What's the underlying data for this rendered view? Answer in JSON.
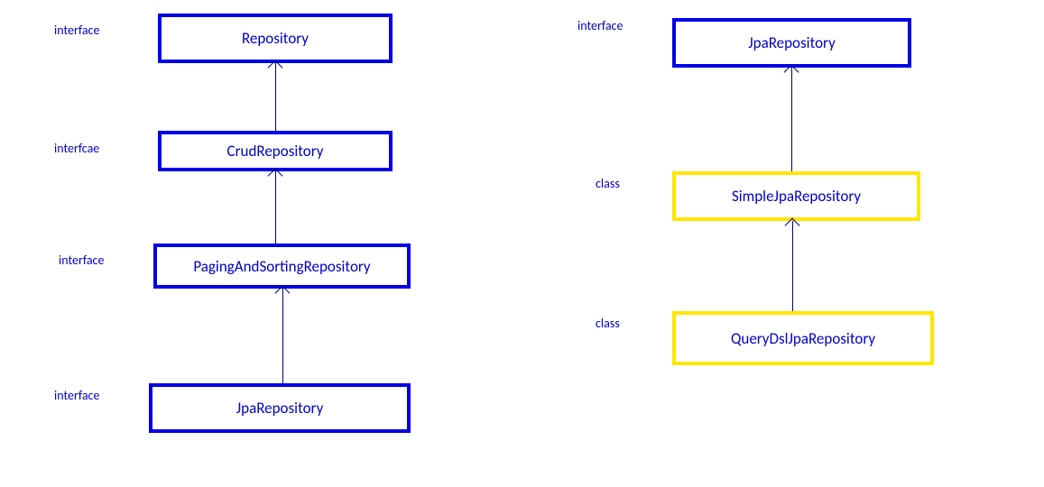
{
  "left": {
    "label1": "interface",
    "box1": "Repository",
    "label2": "interfcae",
    "box2": "CrudRepository",
    "label3": "interface",
    "box3": "PagingAndSortingRepository",
    "label4": "interface",
    "box4": "JpaRepository"
  },
  "right": {
    "label1": "interface",
    "box1": "JpaRepository",
    "label2": "class",
    "box2": "SimpleJpaRepository",
    "label3": "class",
    "box3": "QueryDslJpaRepository"
  },
  "colors": {
    "interfaceBorder": "#0000e6",
    "classBorder": "#ffe600",
    "text": "#0000c8",
    "arrow": "#000080"
  }
}
